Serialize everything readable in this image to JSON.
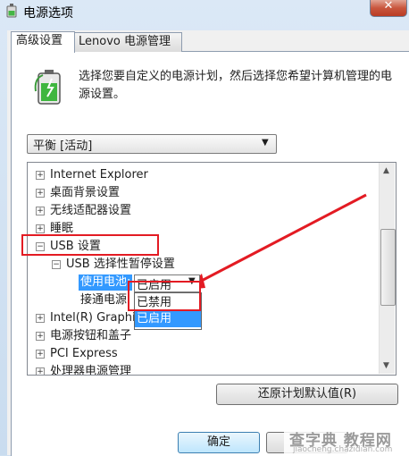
{
  "window": {
    "title": "电源选项",
    "close_glyph": "✕"
  },
  "tabs": [
    {
      "label": "高级设置"
    },
    {
      "label": "Lenovo 电源管理"
    }
  ],
  "description": "选择您要自定义的电源计划，然后选择您希望计算机管理的电源设置。",
  "plan_select": {
    "value": "平衡 [活动]"
  },
  "tree": {
    "items": [
      {
        "label": "Internet Explorer",
        "expander": "+"
      },
      {
        "label": "桌面背景设置",
        "expander": "+"
      },
      {
        "label": "无线适配器设置",
        "expander": "+"
      },
      {
        "label": "睡眠",
        "expander": "+"
      },
      {
        "label": "USB 设置",
        "expander": "−"
      },
      {
        "label": "USB 选择性暂停设置",
        "expander": "−"
      },
      {
        "label": "使用电池:",
        "selected": true
      },
      {
        "label": "接通电源:"
      },
      {
        "label": "Intel(R) Graphi",
        "expander": "+"
      },
      {
        "label": "电源按钮和盖子",
        "expander": "+"
      },
      {
        "label": "PCI Express",
        "expander": "+"
      },
      {
        "label": "处理器电源管理",
        "expander": "+"
      }
    ]
  },
  "battery_combo": {
    "value": "已启用"
  },
  "dropdown": {
    "options": [
      "已禁用",
      "已启用"
    ],
    "selected": "已启用"
  },
  "buttons": {
    "restore": "还原计划默认值(R)",
    "ok": "确定",
    "cancel": ""
  },
  "watermark": {
    "main": "查字典 教程网",
    "sub": "jiaocheng.chazidian.com"
  },
  "colors": {
    "highlight": "#e31b23",
    "selection": "#3399ff"
  }
}
